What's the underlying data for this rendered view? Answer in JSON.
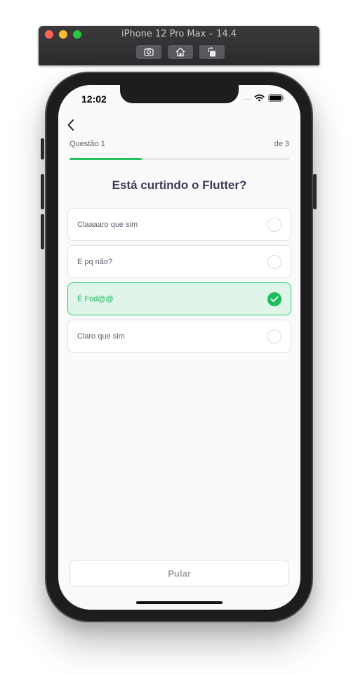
{
  "simulator": {
    "title": "iPhone 12 Pro Max – 14.4",
    "buttons": [
      "screenshot-icon",
      "home-icon",
      "rotate-icon"
    ]
  },
  "status_bar": {
    "time": "12:02",
    "signal": "....",
    "icons": [
      "wifi-icon",
      "battery-icon"
    ]
  },
  "quiz": {
    "question_label": "Questão 1",
    "total_label": "de 3",
    "progress": 0.33,
    "question": "Está curtindo o Flutter?",
    "answers": [
      {
        "label": "Claaaaro que sim",
        "selected": false
      },
      {
        "label": "E pq não?",
        "selected": false
      },
      {
        "label": "É Fod@@",
        "selected": true
      },
      {
        "label": "Claro que sim",
        "selected": false
      }
    ],
    "skip_label": "Pular"
  },
  "colors": {
    "accent_green": "#22c55e",
    "selected_bg": "#e0f5ea",
    "title_text": "#3d3a58"
  }
}
